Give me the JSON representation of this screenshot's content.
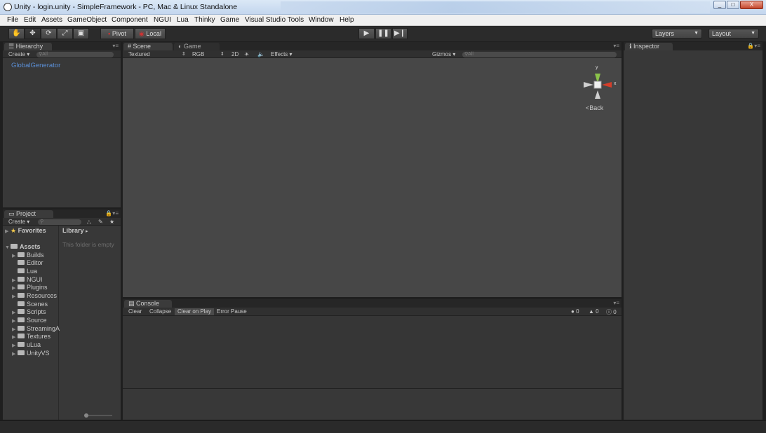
{
  "window": {
    "title": "Unity - login.unity - SimpleFramework - PC, Mac & Linux Standalone",
    "min_label": "_",
    "max_label": "□",
    "close_label": "X"
  },
  "menu": [
    "File",
    "Edit",
    "Assets",
    "GameObject",
    "Component",
    "NGUI",
    "Lua",
    "Thinky",
    "Game",
    "Visual Studio Tools",
    "Window",
    "Help"
  ],
  "toolbar": {
    "tools": [
      "hand-icon",
      "move-icon",
      "rotate-icon",
      "scale-icon",
      "rect-icon"
    ],
    "pivot_label": "Pivot",
    "local_label": "Local",
    "layers_label": "Layers",
    "layout_label": "Layout"
  },
  "hierarchy": {
    "tab_label": "Hierarchy",
    "create_label": "Create",
    "search_placeholder": "All",
    "items": [
      "GlobalGenerator"
    ]
  },
  "scene": {
    "tab_label": "Scene",
    "game_tab_label": "Game",
    "draw_mode": "Textured",
    "render_mode": "RGB",
    "mode_2d": "2D",
    "effects_label": "Effects",
    "gizmos_label": "Gizmos",
    "search_placeholder": "All",
    "gizmo_y": "y",
    "gizmo_x": "x",
    "view_label": "Back"
  },
  "inspector": {
    "tab_label": "Inspector"
  },
  "project": {
    "tab_label": "Project",
    "create_label": "Create",
    "favorites_label": "Favorites",
    "assets_label": "Assets",
    "folders": [
      "Builds",
      "Editor",
      "Lua",
      "NGUI",
      "Plugins",
      "Resources",
      "Scenes",
      "Scripts",
      "Source",
      "StreamingA",
      "Textures",
      "uLua",
      "UnityVS"
    ],
    "library_label": "Library",
    "empty_text": "This folder is empty"
  },
  "console": {
    "tab_label": "Console",
    "buttons": [
      "Clear",
      "Collapse",
      "Clear on Play",
      "Error Pause"
    ],
    "errors": "0",
    "warnings": "0",
    "logs": "0"
  }
}
